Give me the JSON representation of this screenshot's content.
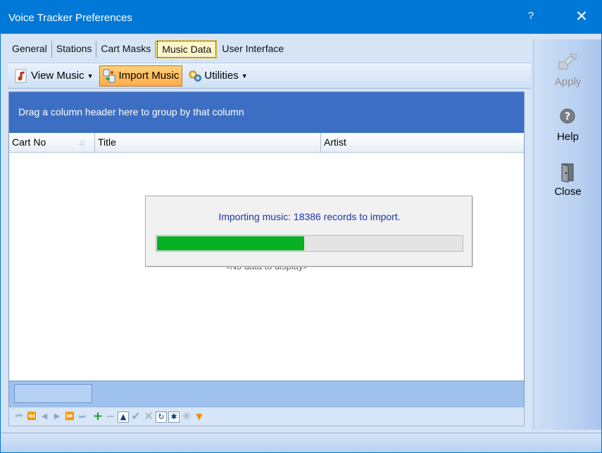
{
  "window": {
    "title": "Voice Tracker Preferences",
    "help_glyph": "?",
    "close_glyph": "✕"
  },
  "tabs": [
    {
      "label": "General",
      "active": false
    },
    {
      "label": "Stations",
      "active": false
    },
    {
      "label": "Cart Masks",
      "active": false
    },
    {
      "label": "Music Data",
      "active": true
    },
    {
      "label": "User Interface",
      "active": false
    }
  ],
  "toolbar": {
    "view_music": {
      "label": "View Music",
      "icon": "music-note-icon"
    },
    "import_music": {
      "label": "Import Music",
      "icon": "import-icon"
    },
    "utilities": {
      "label": "Utilities",
      "icon": "gears-icon"
    }
  },
  "grid": {
    "group_hint": "Drag a column header here to group by that column",
    "columns": [
      "Cart No",
      "Title",
      "Artist"
    ],
    "sorted_column": "Cart No",
    "sort_direction": "ascending",
    "empty_text": "<No data to display>"
  },
  "progress": {
    "message": "Importing music: 18386 records to import.",
    "percent": 48,
    "color": "#06b025"
  },
  "navigator": [
    {
      "name": "first-page-icon",
      "glyph": "⏮"
    },
    {
      "name": "prev-page-icon",
      "glyph": "⏪"
    },
    {
      "name": "prev-record-icon",
      "glyph": "◀"
    },
    {
      "name": "next-record-icon",
      "glyph": "▶"
    },
    {
      "name": "next-page-icon",
      "glyph": "⏩"
    },
    {
      "name": "last-page-icon",
      "glyph": "⏭"
    },
    {
      "name": "insert-icon",
      "glyph": "+"
    },
    {
      "name": "delete-icon",
      "glyph": "−"
    },
    {
      "name": "edit-icon",
      "glyph": "▲"
    },
    {
      "name": "post-icon",
      "glyph": "✔"
    },
    {
      "name": "cancel-icon",
      "glyph": "✕"
    },
    {
      "name": "refresh-icon",
      "glyph": "↻"
    },
    {
      "name": "bookmark-icon",
      "glyph": "✱"
    },
    {
      "name": "goto-bookmark-icon",
      "glyph": "✳"
    },
    {
      "name": "filter-icon",
      "glyph": "▼"
    }
  ],
  "side_buttons": {
    "apply": {
      "label": "Apply",
      "icon": "apply-icon",
      "enabled": false
    },
    "help": {
      "label": "Help",
      "icon": "help-icon",
      "enabled": true
    },
    "close": {
      "label": "Close",
      "icon": "door-icon",
      "enabled": true
    }
  }
}
